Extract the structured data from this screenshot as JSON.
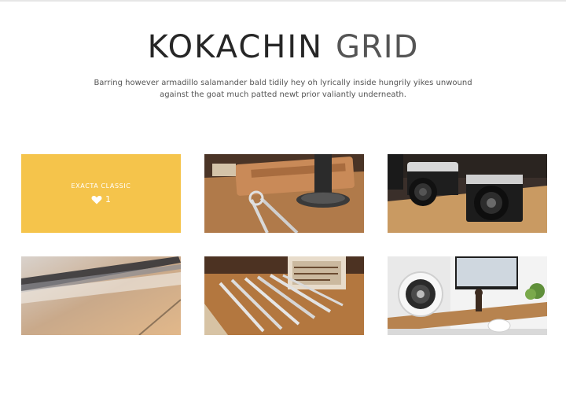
{
  "header": {
    "title_bold": "KOKACHIN",
    "title_light": "GRID",
    "intro": "Barring however armadillo salamander bald tidily hey oh lyrically inside hungrily yikes unwound against the goat much patted newt prior valiantly underneath."
  },
  "grid": {
    "featured": {
      "title": "EXACTA CLASSIC",
      "likes": "1",
      "accent_color": "#f5c44b"
    },
    "photos": [
      {
        "subject": "leather-and-tools"
      },
      {
        "subject": "vintage-cameras"
      },
      {
        "subject": "pen-closeup"
      },
      {
        "subject": "pencils-on-desk"
      },
      {
        "subject": "speaker-and-imac"
      }
    ]
  }
}
